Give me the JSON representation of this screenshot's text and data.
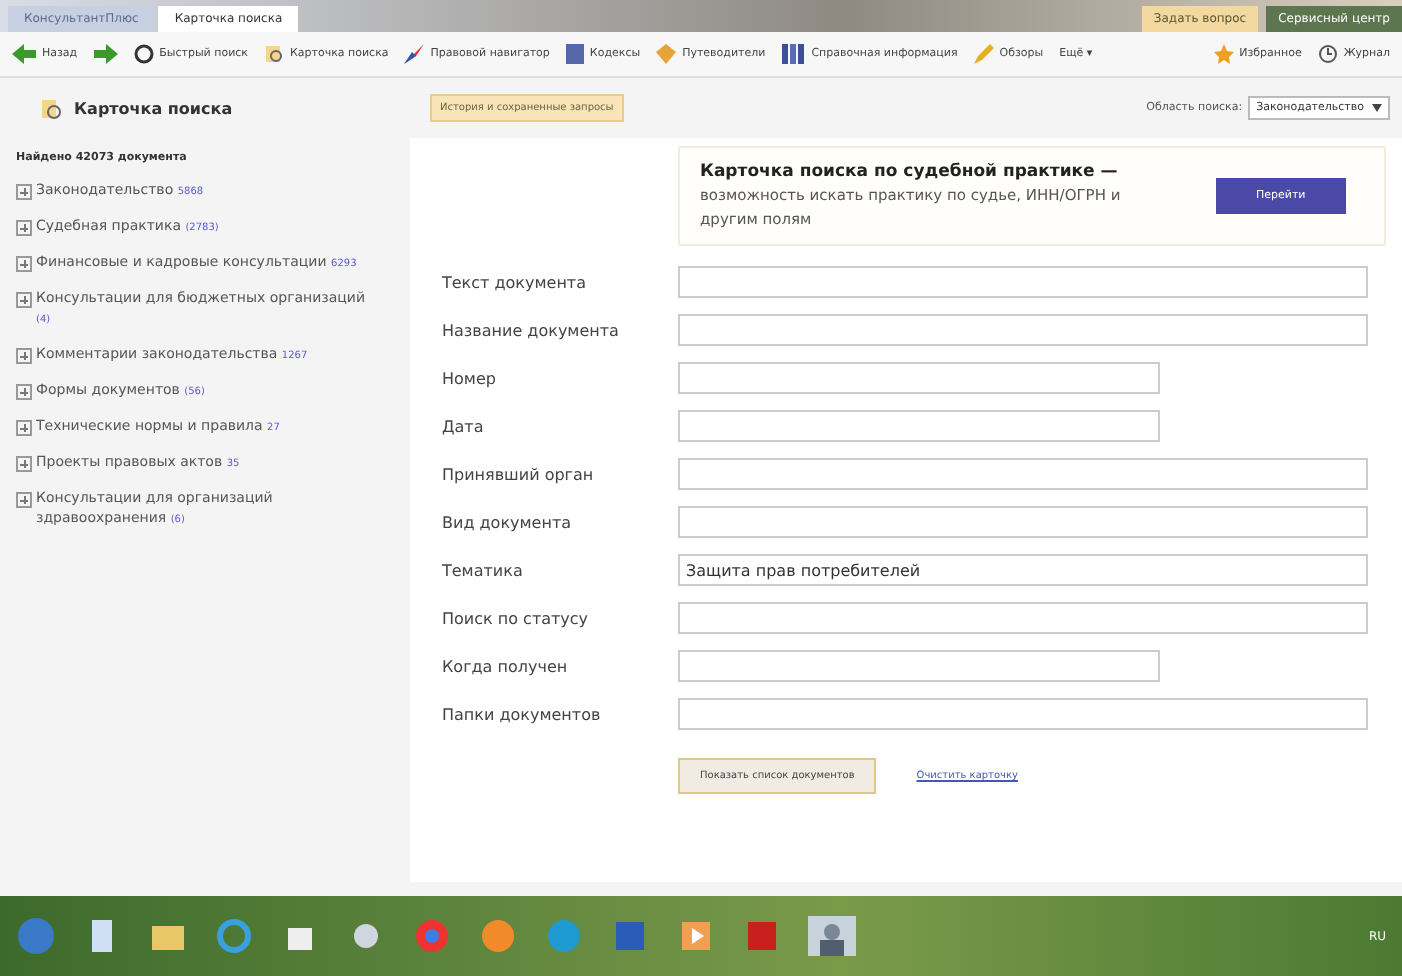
{
  "tabs": [
    {
      "label": "КонсультантПлюс",
      "selected": false
    },
    {
      "label": "Карточка поиска",
      "selected": true
    }
  ],
  "top_buttons": [
    "Задать вопрос",
    "Сервисный центр"
  ],
  "toolbar": [
    "Назад",
    "Быстрый поиск",
    "Карточка поиска",
    "Правовой навигатор",
    "Кодексы",
    "Путеводители",
    "Справочная информация",
    "Обзоры",
    "Ещё ▾"
  ],
  "toolbar_right": [
    "Избранное",
    "Журнал"
  ],
  "sidebar": {
    "title": "Карточка поиска",
    "found": "Найдено 42073 документа",
    "items": [
      {
        "label": "Законодательство",
        "count": "5868"
      },
      {
        "label": "Судебная практика",
        "count": "(2783)"
      },
      {
        "label": "Финансовые и кадровые консультации",
        "count": "6293"
      },
      {
        "label": "Консультации для бюджетных организаций",
        "count": "(4)"
      },
      {
        "label": "Комментарии законодательства",
        "count": "1267"
      },
      {
        "label": "Формы документов",
        "count": "(56)"
      },
      {
        "label": "Технические нормы и правила",
        "count": "27"
      },
      {
        "label": "Проекты правовых актов",
        "count": "35"
      },
      {
        "label": "Консультации для организаций здравоохранения",
        "count": "(6)"
      }
    ]
  },
  "history_button": "История и сохраненные запросы",
  "search_area": {
    "label": "Область поиска:",
    "value": "Законодательство"
  },
  "banner": {
    "title": "Карточка поиска по судебной практике —",
    "text": "возможность искать практику по судье, ИНН/ОГРН и другим полям",
    "button": "Перейти"
  },
  "fields": [
    {
      "label": "Текст документа"
    },
    {
      "label": "Название документа"
    },
    {
      "label": "Номер"
    },
    {
      "label": "Дата"
    },
    {
      "label": "Принявший орган"
    },
    {
      "label": "Вид документа"
    },
    {
      "label": "Тематика",
      "value": "Защита прав потребителей"
    },
    {
      "label": "Поиск по статусу"
    },
    {
      "label": "Когда получен"
    },
    {
      "label": "Папки документов"
    }
  ],
  "show_button": "Показать список документов",
  "clear_link": "Очистить карточку",
  "tray": "RU"
}
